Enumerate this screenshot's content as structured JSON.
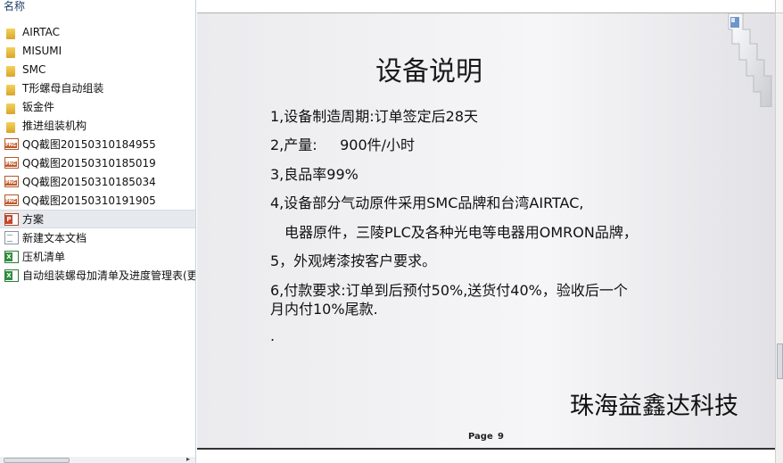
{
  "file_pane": {
    "column_header": "名称",
    "files": [
      {
        "name": "AIRTAC",
        "icon": "folder-icon"
      },
      {
        "name": "MISUMI",
        "icon": "folder-icon"
      },
      {
        "name": "SMC",
        "icon": "folder-icon"
      },
      {
        "name": "T形螺母自动组装",
        "icon": "folder-icon"
      },
      {
        "name": "钣金件",
        "icon": "folder-icon"
      },
      {
        "name": "推进组装机构",
        "icon": "folder-icon"
      },
      {
        "name": "QQ截图20150310184955",
        "icon": "png-icon"
      },
      {
        "name": "QQ截图20150310185019",
        "icon": "png-icon"
      },
      {
        "name": "QQ截图20150310185034",
        "icon": "png-icon"
      },
      {
        "name": "QQ截图20150310191905",
        "icon": "png-icon"
      },
      {
        "name": "方案",
        "icon": "ppt-icon",
        "selected": true
      },
      {
        "name": "新建文本文档",
        "icon": "txt-icon"
      },
      {
        "name": "压机清单",
        "icon": "xls-icon"
      },
      {
        "name": "自动组装螺母加清单及进度管理表(更",
        "icon": "xls-icon"
      }
    ]
  },
  "slide": {
    "title": "设备说明",
    "lines": {
      "b1": "1,设备制造周期:订单签定后28天",
      "b2": "2,产量:     900件/小时",
      "b3": "3,良品率99%",
      "b4a": "4,设备部分气动原件采用SMC品牌和台湾AIRTAC,",
      "b4b": "电器原件，三陵PLC及各种光电等电器用OMRON品牌，",
      "b5": "5，外观烤漆按客户要求。",
      "b6a": "6,付款要求:订单到后预付50%,送货付40%，验收后一个",
      "b6b": "月内付10%尾款.",
      "b7": "."
    },
    "company": "珠海益鑫达科技",
    "page_label": "Page",
    "page_number": "9"
  },
  "colors": {
    "folder": "#e3b43c",
    "selection": "#e6e9ee",
    "slide_background": "#eeeef1"
  }
}
